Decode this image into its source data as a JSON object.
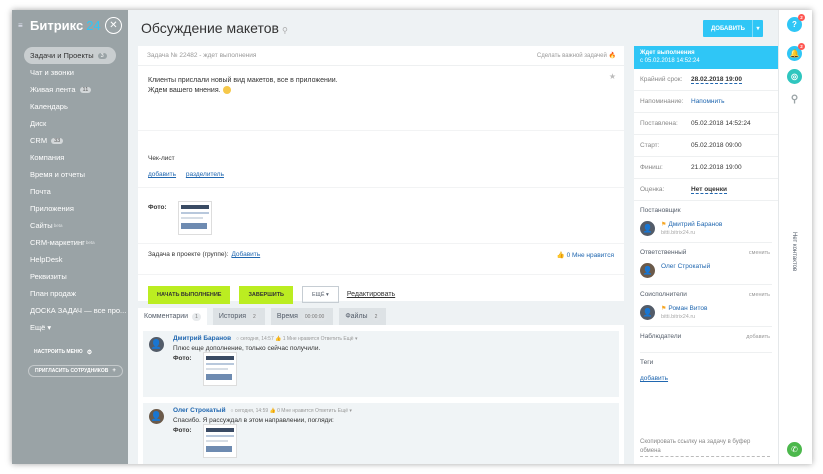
{
  "sidebar": {
    "logo": "Битрикс",
    "logo_num": "24",
    "items": [
      {
        "label": "Задачи и Проекты",
        "badge": "3"
      },
      {
        "label": "Чат и звонки"
      },
      {
        "label": "Живая лента",
        "badge": "11"
      },
      {
        "label": "Календарь"
      },
      {
        "label": "Диск"
      },
      {
        "label": "CRM",
        "badge": "33"
      },
      {
        "label": "Компания"
      },
      {
        "label": "Время и отчеты"
      },
      {
        "label": "Почта"
      },
      {
        "label": "Приложения"
      },
      {
        "label": "Сайты",
        "sup": "beta"
      },
      {
        "label": "CRM-маркетинг",
        "sup": "beta"
      },
      {
        "label": "HelpDesk"
      },
      {
        "label": "Реквизиты"
      },
      {
        "label": "План продаж"
      },
      {
        "label": "ДОСКА ЗАДАЧ — все про..."
      },
      {
        "label": "Ещё ▾"
      }
    ],
    "configure_menu": "НАСТРОИТЬ МЕНЮ",
    "invite": "ПРИГЛАСИТЬ СОТРУДНИКОВ"
  },
  "header": {
    "title": "Обсуждение макетов",
    "add_button": "ДОБАВИТЬ"
  },
  "task": {
    "head": "Задача № 22482 - ждет выполнения",
    "important": "Сделать важной задачей",
    "desc_line1": "Клиенты прислали новый вид макетов, все в приложении.",
    "desc_line2": "Ждем вашего мнения.",
    "checklist_title": "Чек-лист",
    "checklist_add": "добавить",
    "checklist_sep": "разделитель",
    "photo_label": "Фото:",
    "project_label": "Задача в проекте (группе):",
    "project_add": "Добавить",
    "likes": "0 Мне нравится",
    "btn_start": "НАЧАТЬ ВЫПОЛНЕНИЕ",
    "btn_finish": "ЗАВЕРШИТЬ",
    "btn_more": "ЕЩЁ",
    "btn_edit": "Редактировать"
  },
  "tabs": [
    {
      "label": "Комментарии",
      "count": "1"
    },
    {
      "label": "История",
      "count": "2"
    },
    {
      "label": "Время",
      "count": "00:00:00"
    },
    {
      "label": "Файлы",
      "count": "2"
    }
  ],
  "comments": [
    {
      "author": "Дмитрий Баранов",
      "meta": "○ сегодня, 14:57   👍 1 Мне нравится   Ответить   Ещё ▾",
      "text": "Плюс еще дополнение, только сейчас получили.",
      "photo_label": "Фото:"
    },
    {
      "author": "Олег Строкатый",
      "meta": "○ сегодня, 14:59   👍 0 Мне нравится   Ответить   Ещё ▾",
      "text": "Спасибо. Я рассуждал в этом направлении, погляди:",
      "photo_label": "Фото:"
    }
  ],
  "right": {
    "status": "Ждет выполнения",
    "status_since": "с 05.02.2018 14:52:24",
    "fields": [
      {
        "label": "Крайний срок:",
        "value": "28.02.2018 19:00"
      },
      {
        "label": "Напоминание:",
        "value": "Напомнить"
      },
      {
        "label": "Поставлена:",
        "value": "05.02.2018 14:52:24"
      },
      {
        "label": "Старт:",
        "value": "05.02.2018 09:00"
      },
      {
        "label": "Финиш:",
        "value": "21.02.2018 19:00"
      },
      {
        "label": "Оценка:",
        "value": "Нет оценки"
      }
    ],
    "creator_title": "Постановщик",
    "creator_name": "Дмитрий Баранов",
    "creator_sub": "bitti.bitrix24.ru",
    "responsible_title": "Ответственный",
    "responsible_change": "сменить",
    "responsible_name": "Олег Строкатый",
    "coexec_title": "Соисполнители",
    "coexec_change": "сменить",
    "coexec_name": "Роман Витов",
    "coexec_sub": "bitti.bitrix24.ru",
    "observers_title": "Наблюдатели",
    "observers_add": "добавить",
    "tags_title": "Теги",
    "tags_add": "добавить",
    "copy_link": "Скопировать ссылку на задачу в буфер обмена"
  },
  "rbar": {
    "help": "?",
    "help_count": "2",
    "bell_count": "2",
    "contacts": "Нет контактов"
  }
}
